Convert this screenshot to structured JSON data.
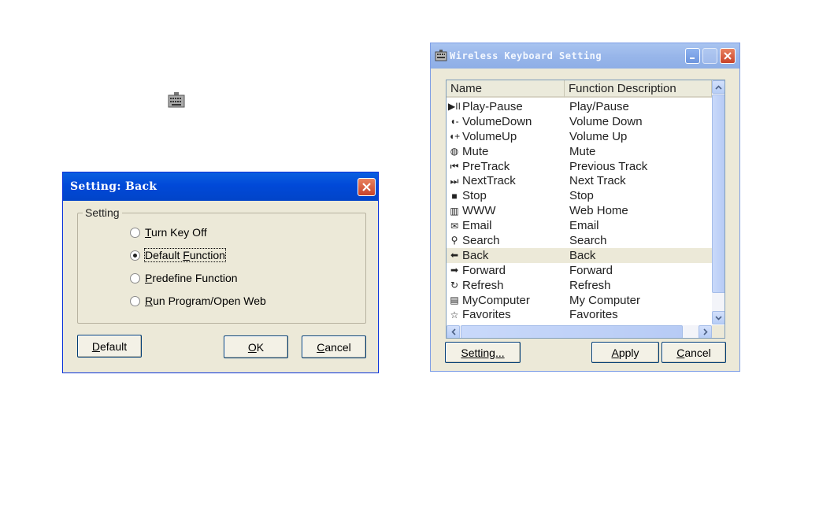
{
  "tray_icon": "keyboard-icon",
  "setting_dialog": {
    "title": "Setting: Back",
    "group_label": "Setting",
    "options": [
      {
        "pre": "",
        "key": "T",
        "post": "urn Key Off",
        "selected": false
      },
      {
        "pre": "Default ",
        "key": "F",
        "post": "unction",
        "selected": true
      },
      {
        "pre": "",
        "key": "P",
        "post": "redefine Function",
        "selected": false
      },
      {
        "pre": "",
        "key": "R",
        "post": "un Program/Open Web",
        "selected": false
      }
    ],
    "buttons": {
      "default": {
        "key": "D",
        "post": "efault"
      },
      "ok": {
        "key": "O",
        "post": "K"
      },
      "cancel": {
        "key": "C",
        "post": "ancel"
      }
    }
  },
  "keyboard_dialog": {
    "title": "Wireless Keyboard Setting",
    "columns": {
      "name": "Name",
      "description": "Function Description"
    },
    "rows": [
      {
        "icon": "play-pause-icon",
        "glyph": "▶II",
        "name": "Play-Pause",
        "description": "Play/Pause"
      },
      {
        "icon": "volume-down-icon",
        "glyph": "◖-",
        "name": "VolumeDown",
        "description": "Volume Down"
      },
      {
        "icon": "volume-up-icon",
        "glyph": "◖+",
        "name": "VolumeUp",
        "description": "Volume Up"
      },
      {
        "icon": "mute-icon",
        "glyph": "◍",
        "name": "Mute",
        "description": "Mute"
      },
      {
        "icon": "previous-track-icon",
        "glyph": "⏮",
        "name": "PreTrack",
        "description": "Previous Track"
      },
      {
        "icon": "next-track-icon",
        "glyph": "⏭",
        "name": "NextTrack",
        "description": "Next Track"
      },
      {
        "icon": "stop-icon",
        "glyph": "■",
        "name": "Stop",
        "description": "Stop"
      },
      {
        "icon": "www-icon",
        "glyph": "▥",
        "name": "WWW",
        "description": "Web Home"
      },
      {
        "icon": "email-icon",
        "glyph": "✉",
        "name": "Email",
        "description": "Email"
      },
      {
        "icon": "search-icon",
        "glyph": "⚲",
        "name": "Search",
        "description": "Search"
      },
      {
        "icon": "back-arrow-icon",
        "glyph": "⬅",
        "name": "Back",
        "description": "Back",
        "selected": true
      },
      {
        "icon": "forward-arrow-icon",
        "glyph": "➡",
        "name": "Forward",
        "description": "Forward"
      },
      {
        "icon": "refresh-icon",
        "glyph": "↻",
        "name": "Refresh",
        "description": "Refresh"
      },
      {
        "icon": "computer-icon",
        "glyph": "▤",
        "name": "MyComputer",
        "description": "My Computer"
      },
      {
        "icon": "favorites-icon",
        "glyph": "☆",
        "name": "Favorites",
        "description": "Favorites"
      }
    ],
    "buttons": {
      "setting": {
        "key": "S",
        "post": "etting..."
      },
      "apply": {
        "key": "A",
        "post": "pply"
      },
      "cancel": {
        "key": "C",
        "post": "ancel"
      }
    }
  },
  "colors": {
    "active_titlebar": "#0149d8",
    "inactive_titlebar": "#98b6ea",
    "dialog_face": "#ece9d8",
    "close_button": "#c8432a"
  }
}
